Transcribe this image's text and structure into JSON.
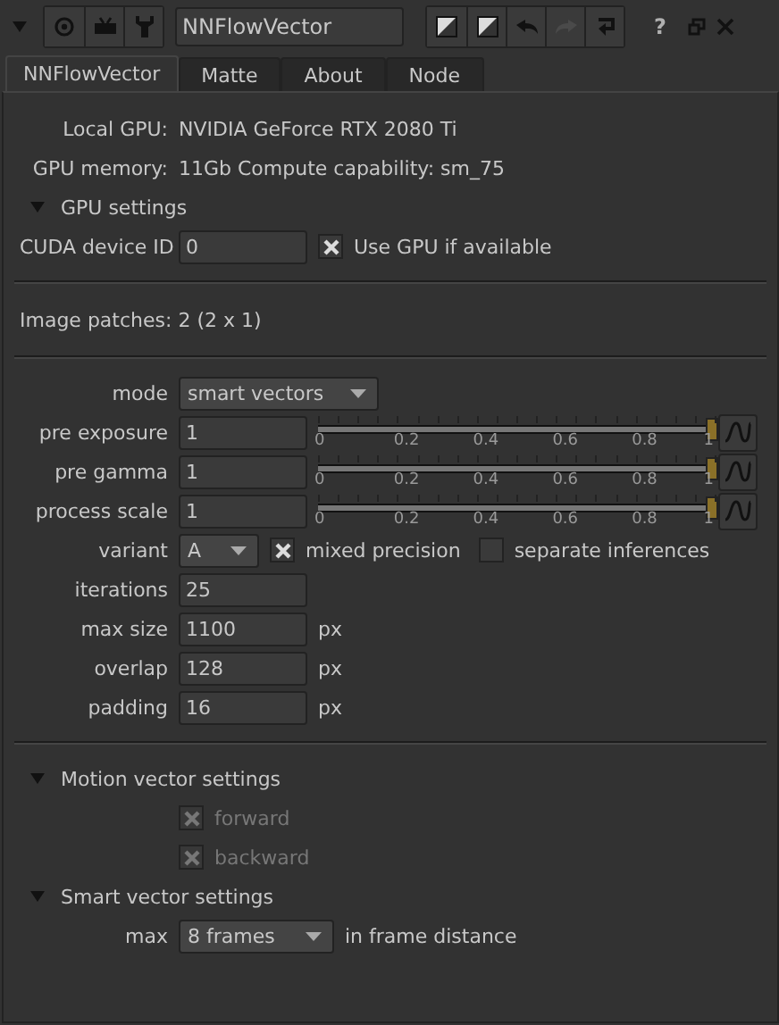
{
  "toolbar": {
    "node_name": "NNFlowVector",
    "help": "?"
  },
  "tabs": [
    {
      "label": "NNFlowVector",
      "selected": true
    },
    {
      "label": "Matte",
      "selected": false
    },
    {
      "label": "About",
      "selected": false
    },
    {
      "label": "Node",
      "selected": false
    }
  ],
  "info": [
    {
      "label": "Local GPU:",
      "value": "NVIDIA GeForce RTX 2080 Ti"
    },
    {
      "label": "GPU memory:",
      "value": "11Gb   Compute capability: sm_75"
    }
  ],
  "gpu_settings": {
    "title": "GPU settings",
    "expanded": true,
    "cuda_label": "CUDA device ID",
    "cuda_value": "0",
    "use_gpu": {
      "label": "Use GPU if available",
      "checked": true
    }
  },
  "image_patches": "Image patches: 2 (2 x 1)",
  "params": [
    {
      "kind": "dropdown",
      "label": "mode",
      "value": "smart vectors"
    },
    {
      "kind": "slider",
      "label": "pre exposure",
      "value": "1",
      "level": 1,
      "ticks": [
        "0",
        "0.2",
        "0.4",
        "0.6",
        "0.8",
        "1"
      ]
    },
    {
      "kind": "slider",
      "label": "pre gamma",
      "value": "1",
      "level": 1,
      "ticks": [
        "0",
        "0.2",
        "0.4",
        "0.6",
        "0.8",
        "1"
      ]
    },
    {
      "kind": "slider",
      "label": "process scale",
      "value": "1",
      "level": 1,
      "ticks": [
        "0",
        "0.2",
        "0.4",
        "0.6",
        "0.8",
        "1"
      ]
    },
    {
      "kind": "variant",
      "label": "variant",
      "value": "A",
      "options": [
        {
          "label": "mixed precision",
          "checked": true
        },
        {
          "label": "separate inferences",
          "checked": false
        }
      ]
    },
    {
      "kind": "number",
      "label": "iterations",
      "value": "25"
    },
    {
      "kind": "number",
      "label": "max size",
      "value": "1100",
      "unit": "px"
    },
    {
      "kind": "number",
      "label": "overlap",
      "value": "128",
      "unit": "px"
    },
    {
      "kind": "number",
      "label": "padding",
      "value": "16",
      "unit": "px"
    }
  ],
  "motion_vector_settings": {
    "title": "Motion vector settings",
    "expanded": true,
    "options": [
      {
        "label": "forward",
        "checked": true,
        "disabled": true
      },
      {
        "label": "backward",
        "checked": true,
        "disabled": true
      }
    ]
  },
  "smart_vector_settings": {
    "title": "Smart vector settings",
    "expanded": true,
    "label": "max",
    "value": "8 frames",
    "suffix": "in frame distance"
  }
}
